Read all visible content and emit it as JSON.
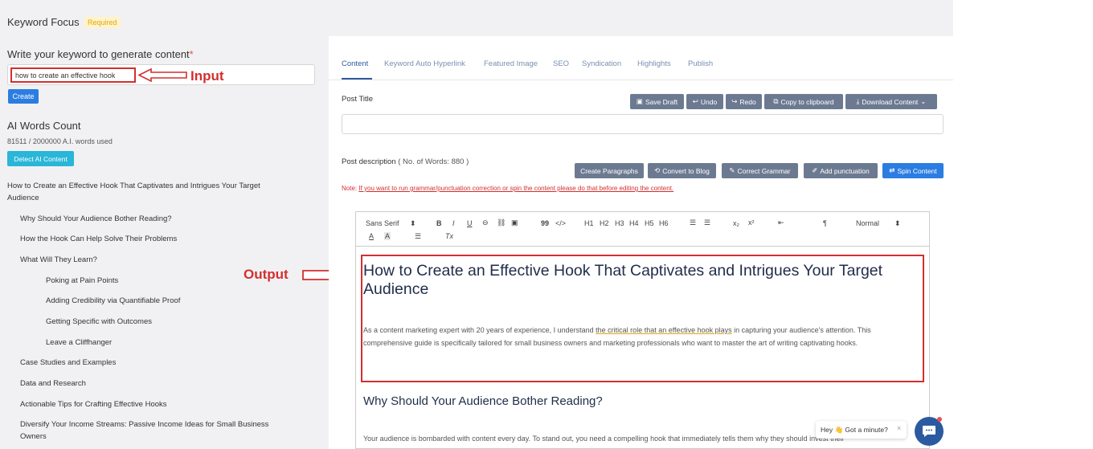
{
  "keyword_focus": {
    "title": "Keyword Focus",
    "badge": "Required"
  },
  "keyword_form": {
    "label": "Write your keyword to generate content",
    "required_mark": "*",
    "input_value": "how to create an effective hook",
    "create_label": "Create"
  },
  "annotations": {
    "input": "Input",
    "output": "Output",
    "color": "#d32f2f"
  },
  "ai_words": {
    "title": "AI Words Count",
    "count": "81511 / 2000000 A.I. words used",
    "detect_label": "Detect AI Content"
  },
  "outline": [
    {
      "text": "How to Create an Effective Hook That Captivates and Intrigues Your Target"
    },
    {
      "text": "Audience"
    },
    {
      "text": "Why Should Your Audience Bother Reading?"
    },
    {
      "text": "How the Hook Can Help Solve Their Problems"
    },
    {
      "text": "What Will They Learn?"
    },
    {
      "text": "Poking at Pain Points"
    },
    {
      "text": "Adding Credibility via Quantifiable Proof"
    },
    {
      "text": "Getting Specific with Outcomes"
    },
    {
      "text": "Leave a Cliffhanger"
    },
    {
      "text": "Case Studies and Examples"
    },
    {
      "text": "Data and Research"
    },
    {
      "text": "Actionable Tips for Crafting Effective Hooks"
    },
    {
      "text": "Diversify Your Income Streams: Passive Income Ideas for Small Business"
    },
    {
      "text": "Owners"
    }
  ],
  "tabs": [
    "Content",
    "Keyword Auto Hyperlink",
    "Featured Image",
    "SEO",
    "Syndication",
    "Highlights",
    "Publish"
  ],
  "post_title": {
    "label": "Post Title",
    "actions": {
      "save_draft": "Save Draft",
      "undo": "Undo",
      "redo": "Redo",
      "copy": "Copy to clipboard",
      "download": "Download Content"
    }
  },
  "post_description": {
    "label": "Post description",
    "words": "( No. of Words: 880 )",
    "actions": {
      "paragraphs": "Create Paragraphs",
      "blog": "Convert to Blog",
      "grammar": "Correct Grammar",
      "punctuation": "Add punctuation",
      "spin": "Spin Content"
    },
    "note_prefix": "Note:",
    "note_text": "If you want to run grammar/punctuation correction or spin the content please do that before editing the content."
  },
  "editor_toolbar": {
    "font": "Sans Serif",
    "size": "Normal",
    "b": "B",
    "i": "I",
    "u": "U",
    "quote": "99",
    "code": "</>",
    "h1": "H1",
    "h2": "H2",
    "h3": "H3",
    "h4": "H4",
    "h5": "H5",
    "h6": "H6",
    "sub": "x₂",
    "sup": "x²",
    "rtl": "¶",
    "color": "A",
    "bg": "A",
    "clear": "Tx"
  },
  "document": {
    "h1": "How to Create an Effective Hook That Captivates and Intrigues Your Target Audience",
    "p1_a": "As a content marketing expert with 20 years of experience, I understand ",
    "p1_hl": "the critical role that an effective hook plays",
    "p1_b": " in capturing your audience's attention. This comprehensive guide is specifically tailored for small business owners and marketing professionals who want to master the art of writing captivating hooks.",
    "h2": "Why Should Your Audience Bother Reading?",
    "p2": "Your audience is bombarded with content every day. To stand out, you need a compelling hook that immediately tells them why they should invest their"
  },
  "chat": {
    "text": "Hey 👋 Got a minute?",
    "close": "×"
  }
}
